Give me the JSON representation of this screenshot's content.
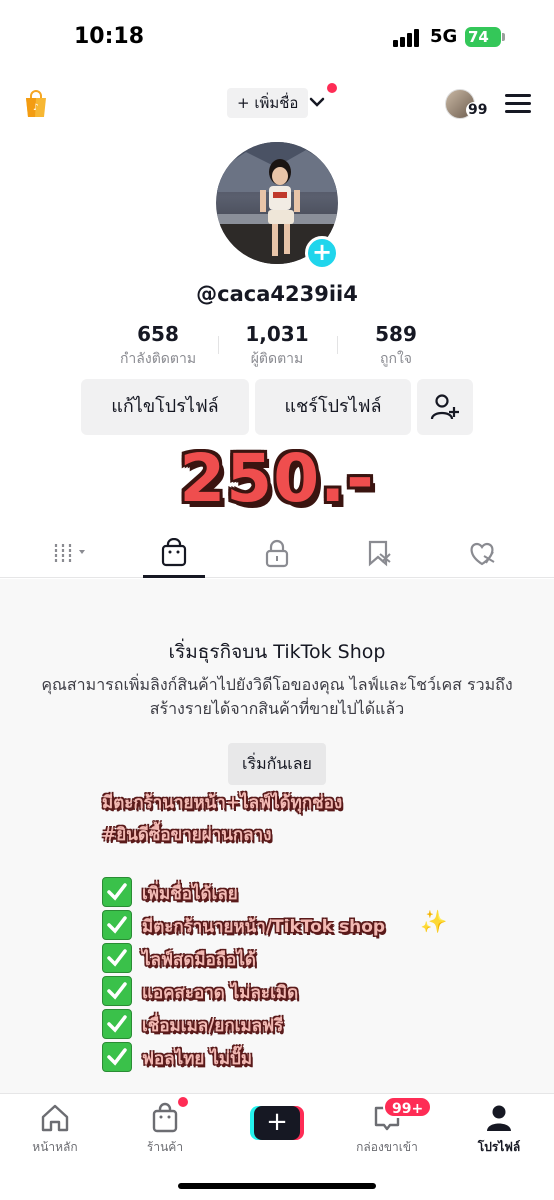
{
  "status_bar": {
    "time": "10:18",
    "network": "5G",
    "battery": "74"
  },
  "top_nav": {
    "add_name_label": "+ เพิ่มชื่อ",
    "avatar_count": "99"
  },
  "profile": {
    "username": "@caca4239ii4",
    "stats": [
      {
        "value": "658",
        "label": "กำลังติดตาม"
      },
      {
        "value": "1,031",
        "label": "ผู้ติดตาม"
      },
      {
        "value": "589",
        "label": "ถูกใจ"
      }
    ],
    "edit_profile_label": "แก้ไขโปรไฟล์",
    "share_profile_label": "แชร์โปรไฟล์"
  },
  "overlay": {
    "price": "250.-",
    "promo_lines": [
      "มีตะกร้านายหน้า+ไลฟ์ได้ทุกช่อง",
      "#ยินดีซื้อขายผ่านกลาง"
    ],
    "checklist": [
      "เพิ่มชื่อได้เลย",
      "มีตะกร้านายหน้า/TikTok shop",
      "ไลฟ์สดมือถือได้",
      "แอคสะอาด ไม่ละเมิด",
      "เชื่อมเมล/ยกเมลฟรี",
      "ฟอลไทย ไม่ปั๊ม"
    ]
  },
  "content_tabs": [
    {
      "icon": "videos-grid-icon"
    },
    {
      "icon": "shop-bag-icon"
    },
    {
      "icon": "lock-icon"
    },
    {
      "icon": "favorites-icon"
    },
    {
      "icon": "liked-icon"
    }
  ],
  "shop": {
    "title": "เริ่มธุรกิจบน TikTok Shop",
    "description": "คุณสามารถเพิ่มลิงก์สินค้าไปยังวิดีโอของคุณ ไลฟ์และโชว์เคส รวมถึงสร้างรายได้จากสินค้าที่ขายไปได้แล้ว",
    "start_label": "เริ่มกันเลย"
  },
  "bottom_nav": {
    "home_label": "หน้าหลัก",
    "shop_label": "ร้านค้า",
    "inbox_label": "กล่องขาเข้า",
    "inbox_badge": "99+",
    "profile_label": "โปรไฟล์"
  },
  "colors": {
    "accent": "#fe2c55",
    "teal": "#20d5ec",
    "battery": "#34c759",
    "price": "#ef4e4e"
  }
}
